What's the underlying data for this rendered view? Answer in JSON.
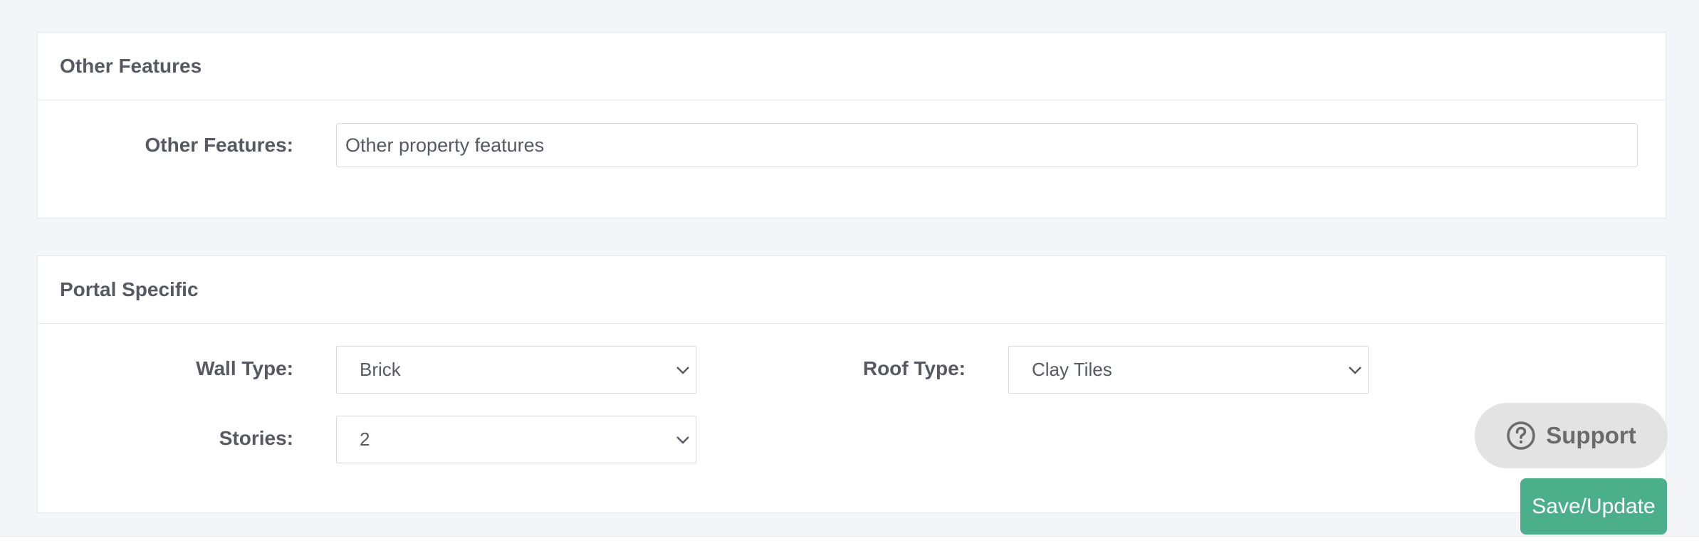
{
  "other_features_section": {
    "title": "Other Features",
    "field_label": "Other Features:",
    "field_placeholder": "Other property features",
    "field_value": ""
  },
  "portal_specific_section": {
    "title": "Portal Specific",
    "wall_type_label": "Wall Type:",
    "wall_type_value": "Brick",
    "roof_type_label": "Roof Type:",
    "roof_type_value": "Clay Tiles",
    "stories_label": "Stories:",
    "stories_value": "2"
  },
  "actions": {
    "support_label": "Support",
    "support_icon": "help-circle-icon",
    "save_label": "Save/Update",
    "save_color": "#4caf8c",
    "support_color": "#e3e3e3"
  }
}
